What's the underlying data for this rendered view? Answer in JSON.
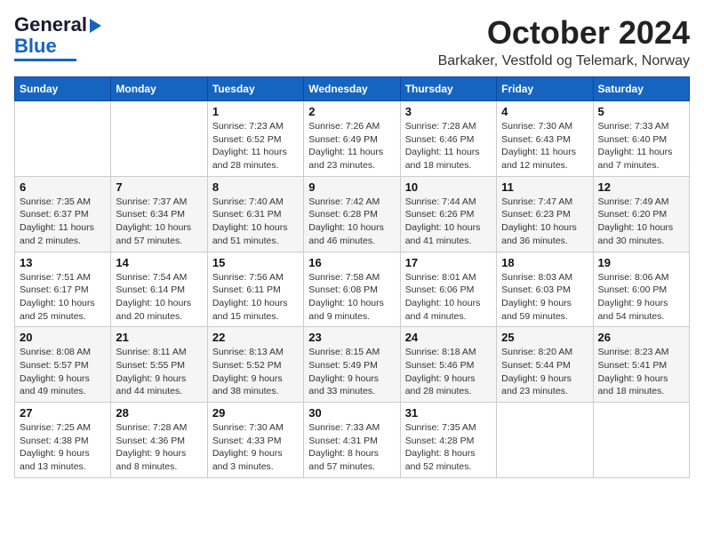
{
  "logo": {
    "line1": "General",
    "line2": "Blue"
  },
  "header": {
    "month": "October 2024",
    "location": "Barkaker, Vestfold og Telemark, Norway"
  },
  "weekdays": [
    "Sunday",
    "Monday",
    "Tuesday",
    "Wednesday",
    "Thursday",
    "Friday",
    "Saturday"
  ],
  "weeks": [
    [
      {
        "day": "",
        "info": ""
      },
      {
        "day": "",
        "info": ""
      },
      {
        "day": "1",
        "info": "Sunrise: 7:23 AM\nSunset: 6:52 PM\nDaylight: 11 hours\nand 28 minutes."
      },
      {
        "day": "2",
        "info": "Sunrise: 7:26 AM\nSunset: 6:49 PM\nDaylight: 11 hours\nand 23 minutes."
      },
      {
        "day": "3",
        "info": "Sunrise: 7:28 AM\nSunset: 6:46 PM\nDaylight: 11 hours\nand 18 minutes."
      },
      {
        "day": "4",
        "info": "Sunrise: 7:30 AM\nSunset: 6:43 PM\nDaylight: 11 hours\nand 12 minutes."
      },
      {
        "day": "5",
        "info": "Sunrise: 7:33 AM\nSunset: 6:40 PM\nDaylight: 11 hours\nand 7 minutes."
      }
    ],
    [
      {
        "day": "6",
        "info": "Sunrise: 7:35 AM\nSunset: 6:37 PM\nDaylight: 11 hours\nand 2 minutes."
      },
      {
        "day": "7",
        "info": "Sunrise: 7:37 AM\nSunset: 6:34 PM\nDaylight: 10 hours\nand 57 minutes."
      },
      {
        "day": "8",
        "info": "Sunrise: 7:40 AM\nSunset: 6:31 PM\nDaylight: 10 hours\nand 51 minutes."
      },
      {
        "day": "9",
        "info": "Sunrise: 7:42 AM\nSunset: 6:28 PM\nDaylight: 10 hours\nand 46 minutes."
      },
      {
        "day": "10",
        "info": "Sunrise: 7:44 AM\nSunset: 6:26 PM\nDaylight: 10 hours\nand 41 minutes."
      },
      {
        "day": "11",
        "info": "Sunrise: 7:47 AM\nSunset: 6:23 PM\nDaylight: 10 hours\nand 36 minutes."
      },
      {
        "day": "12",
        "info": "Sunrise: 7:49 AM\nSunset: 6:20 PM\nDaylight: 10 hours\nand 30 minutes."
      }
    ],
    [
      {
        "day": "13",
        "info": "Sunrise: 7:51 AM\nSunset: 6:17 PM\nDaylight: 10 hours\nand 25 minutes."
      },
      {
        "day": "14",
        "info": "Sunrise: 7:54 AM\nSunset: 6:14 PM\nDaylight: 10 hours\nand 20 minutes."
      },
      {
        "day": "15",
        "info": "Sunrise: 7:56 AM\nSunset: 6:11 PM\nDaylight: 10 hours\nand 15 minutes."
      },
      {
        "day": "16",
        "info": "Sunrise: 7:58 AM\nSunset: 6:08 PM\nDaylight: 10 hours\nand 9 minutes."
      },
      {
        "day": "17",
        "info": "Sunrise: 8:01 AM\nSunset: 6:06 PM\nDaylight: 10 hours\nand 4 minutes."
      },
      {
        "day": "18",
        "info": "Sunrise: 8:03 AM\nSunset: 6:03 PM\nDaylight: 9 hours\nand 59 minutes."
      },
      {
        "day": "19",
        "info": "Sunrise: 8:06 AM\nSunset: 6:00 PM\nDaylight: 9 hours\nand 54 minutes."
      }
    ],
    [
      {
        "day": "20",
        "info": "Sunrise: 8:08 AM\nSunset: 5:57 PM\nDaylight: 9 hours\nand 49 minutes."
      },
      {
        "day": "21",
        "info": "Sunrise: 8:11 AM\nSunset: 5:55 PM\nDaylight: 9 hours\nand 44 minutes."
      },
      {
        "day": "22",
        "info": "Sunrise: 8:13 AM\nSunset: 5:52 PM\nDaylight: 9 hours\nand 38 minutes."
      },
      {
        "day": "23",
        "info": "Sunrise: 8:15 AM\nSunset: 5:49 PM\nDaylight: 9 hours\nand 33 minutes."
      },
      {
        "day": "24",
        "info": "Sunrise: 8:18 AM\nSunset: 5:46 PM\nDaylight: 9 hours\nand 28 minutes."
      },
      {
        "day": "25",
        "info": "Sunrise: 8:20 AM\nSunset: 5:44 PM\nDaylight: 9 hours\nand 23 minutes."
      },
      {
        "day": "26",
        "info": "Sunrise: 8:23 AM\nSunset: 5:41 PM\nDaylight: 9 hours\nand 18 minutes."
      }
    ],
    [
      {
        "day": "27",
        "info": "Sunrise: 7:25 AM\nSunset: 4:38 PM\nDaylight: 9 hours\nand 13 minutes."
      },
      {
        "day": "28",
        "info": "Sunrise: 7:28 AM\nSunset: 4:36 PM\nDaylight: 9 hours\nand 8 minutes."
      },
      {
        "day": "29",
        "info": "Sunrise: 7:30 AM\nSunset: 4:33 PM\nDaylight: 9 hours\nand 3 minutes."
      },
      {
        "day": "30",
        "info": "Sunrise: 7:33 AM\nSunset: 4:31 PM\nDaylight: 8 hours\nand 57 minutes."
      },
      {
        "day": "31",
        "info": "Sunrise: 7:35 AM\nSunset: 4:28 PM\nDaylight: 8 hours\nand 52 minutes."
      },
      {
        "day": "",
        "info": ""
      },
      {
        "day": "",
        "info": ""
      }
    ]
  ]
}
